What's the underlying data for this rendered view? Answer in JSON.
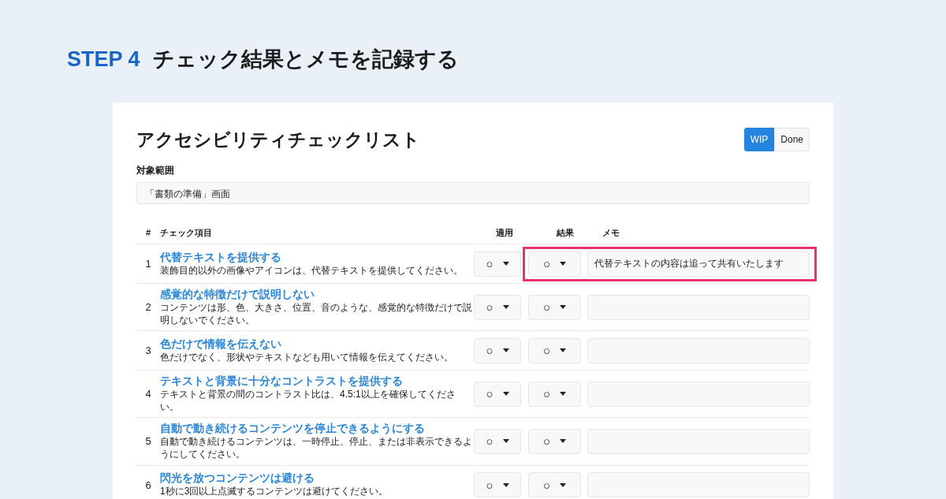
{
  "step": {
    "label": "STEP 4",
    "title": "チェック結果とメモを記録する"
  },
  "card": {
    "title": "アクセシビリティチェックリスト",
    "status": [
      {
        "label": "WIP",
        "selected": true
      },
      {
        "label": "Done",
        "selected": false
      }
    ],
    "scope": {
      "label": "対象範囲",
      "value": "「書類の準備」画面"
    },
    "columns": [
      "#",
      "チェック項目",
      "適用",
      "結果",
      "メモ"
    ],
    "rows": [
      {
        "no": "1",
        "title": "代替テキストを提供する",
        "description": "装飾目的以外の画像やアイコンは、代替テキストを提供してください。",
        "apply": "○",
        "result": "○",
        "memo": "代替テキストの内容は追って共有いたします",
        "highlighted": true
      },
      {
        "no": "2",
        "title": "感覚的な特徴だけで説明しない",
        "description": "コンテンツは形、色、大きさ、位置、音のような、感覚的な特徴だけで説明しないでください。",
        "apply": "○",
        "result": "○",
        "highlighted": false
      },
      {
        "no": "3",
        "title": "色だけで情報を伝えない",
        "description": "色だけでなく、形状やテキストなども用いて情報を伝えてください。",
        "apply": "○",
        "result": "○",
        "highlighted": false
      },
      {
        "no": "4",
        "title": "テキストと背景に十分なコントラストを提供する",
        "description": "テキストと背景の間のコントラスト比は、4.5:1以上を確保してください。",
        "apply": "○",
        "result": "○",
        "highlighted": false
      },
      {
        "no": "5",
        "title": "自動で動き続けるコンテンツを停止できるようにする",
        "description": "自動で動き続けるコンテンツは、一時停止、停止、または非表示できるようにしてください。",
        "apply": "○",
        "result": "○",
        "highlighted": false
      },
      {
        "no": "6",
        "title": "閃光を放つコンテンツは避ける",
        "description": "1秒に3回以上点滅するコンテンツは避けてください。",
        "apply": "○",
        "result": "○",
        "highlighted": false
      }
    ]
  }
}
